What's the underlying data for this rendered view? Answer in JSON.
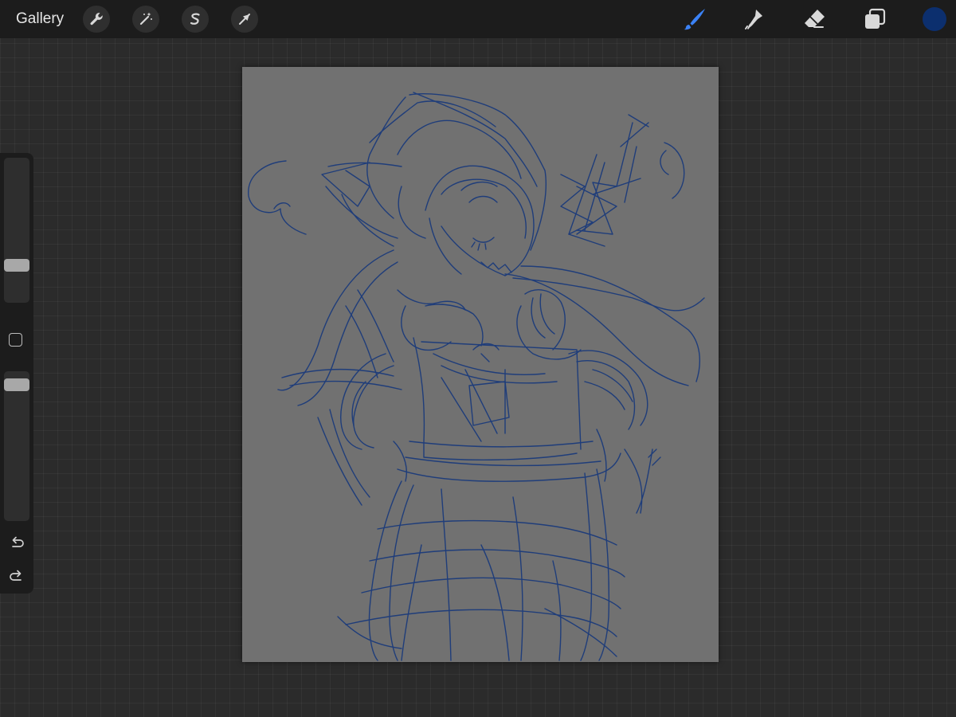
{
  "toolbar": {
    "gallery_label": "Gallery",
    "left_tools": [
      {
        "name": "actions-wrench-icon"
      },
      {
        "name": "adjustments-magic-wand-icon"
      },
      {
        "name": "selection-s-icon"
      },
      {
        "name": "transform-arrow-icon"
      }
    ],
    "right_tools": [
      {
        "name": "brush-icon",
        "active": true
      },
      {
        "name": "smudge-icon",
        "active": false
      },
      {
        "name": "eraser-icon",
        "active": false
      },
      {
        "name": "layers-icon",
        "active": false
      }
    ],
    "current_color": "#0c2f6e"
  },
  "sidebar": {
    "brush_size_slider": {
      "label": "",
      "level": 0.22
    },
    "opacity_slider": {
      "label": "",
      "level": 0.97
    },
    "modify_button": "square-modify-icon",
    "undo_icon": "undo-arrow-icon",
    "redo_icon": "redo-arrow-icon"
  },
  "canvas": {
    "background_color": "#717171",
    "stroke_color": "#1f3d7a",
    "content": "blue-sketch-figure"
  },
  "theme": {
    "accent": "#3b82f6",
    "bar_bg": "#1c1c1c",
    "workspace_bg": "#2b2b2b"
  }
}
